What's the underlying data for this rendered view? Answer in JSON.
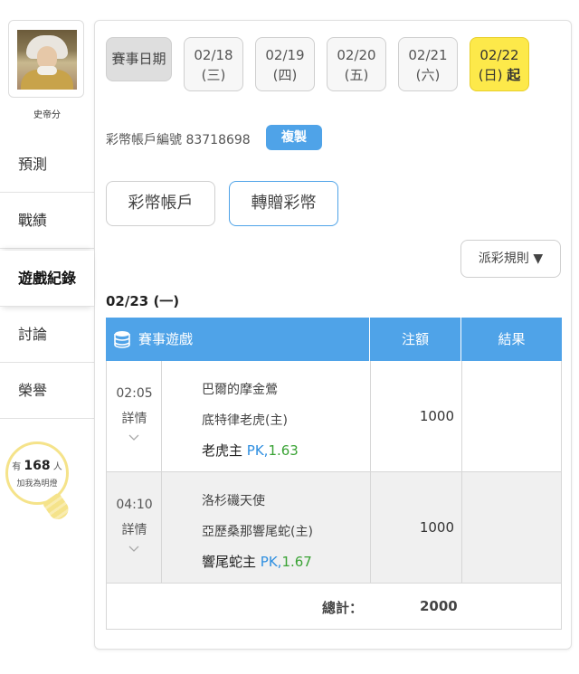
{
  "user": {
    "name": "史帝分"
  },
  "nav": {
    "items": [
      {
        "label": "預測"
      },
      {
        "label": "戰績"
      },
      {
        "label": "遊戲紀錄"
      },
      {
        "label": "討論"
      },
      {
        "label": "榮譽"
      }
    ]
  },
  "fans": {
    "prefix": "有",
    "count": "168",
    "suffix": "人",
    "caption": "加我為明燈"
  },
  "dates": {
    "label": "賽事日期",
    "tabs": [
      {
        "date": "02/18",
        "weekday": "(三)"
      },
      {
        "date": "02/19",
        "weekday": "(四)"
      },
      {
        "date": "02/20",
        "weekday": "(五)"
      },
      {
        "date": "02/21",
        "weekday": "(六)"
      },
      {
        "date": "02/22",
        "weekday": "(日)",
        "suffix": "起"
      }
    ]
  },
  "account": {
    "label": "彩幣帳戶編號",
    "number": "83718698",
    "copy_label": "複製"
  },
  "buttons": {
    "account": "彩幣帳戶",
    "transfer": "轉贈彩幣",
    "rules": "派彩規則 ▼"
  },
  "day_title": "02/23 (一)",
  "table": {
    "headers": {
      "game": "賽事遊戲",
      "bet": "注額",
      "result": "結果"
    },
    "rows": [
      {
        "time": "02:05",
        "detail": "詳情",
        "team1": "巴爾的摩金鶯",
        "team2": "底特律老虎(主)",
        "pick": "老虎主",
        "pk": "PK,",
        "odds": "1.63",
        "bet": "1000",
        "result": ""
      },
      {
        "time": "04:10",
        "detail": "詳情",
        "team1": "洛杉磯天使",
        "team2": "亞歷桑那響尾蛇(主)",
        "pick": "響尾蛇主",
        "pk": "PK,",
        "odds": "1.67",
        "bet": "1000",
        "result": ""
      }
    ],
    "total_label": "總計：",
    "total_value": "2000"
  },
  "colors": {
    "accent": "#4fa3e8",
    "selected_date": "#fde94a",
    "odds": "#3aa335",
    "pk": "#2f8fe0"
  }
}
